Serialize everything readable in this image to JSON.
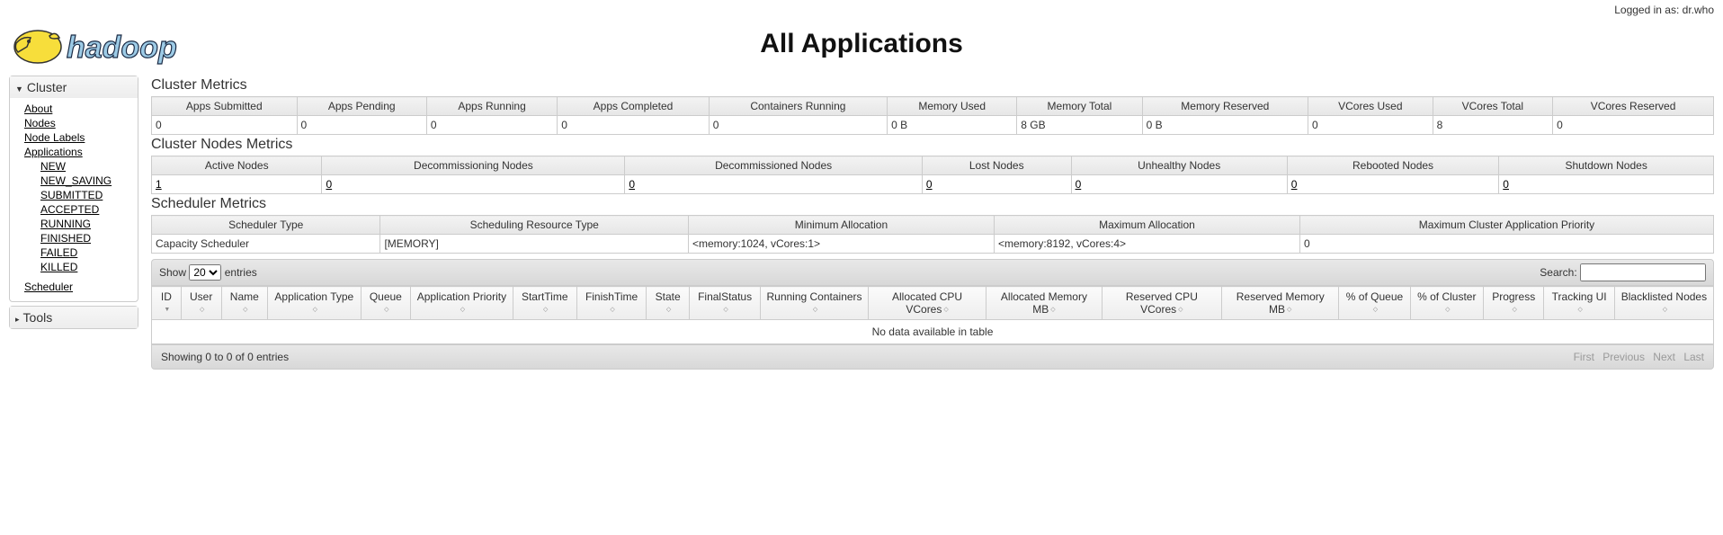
{
  "login": {
    "prefix": "Logged in as: ",
    "user": "dr.who"
  },
  "page_title": "All Applications",
  "sidebar": {
    "cluster": {
      "label": "Cluster",
      "links": {
        "about": "About",
        "nodes": "Nodes",
        "node_labels": "Node Labels",
        "applications": "Applications",
        "scheduler": "Scheduler"
      },
      "app_states": {
        "NEW": "NEW",
        "NEW_SAVING": "NEW_SAVING",
        "SUBMITTED": "SUBMITTED",
        "ACCEPTED": "ACCEPTED",
        "RUNNING": "RUNNING",
        "FINISHED": "FINISHED",
        "FAILED": "FAILED",
        "KILLED": "KILLED"
      }
    },
    "tools": {
      "label": "Tools"
    }
  },
  "sections": {
    "cluster_metrics": "Cluster Metrics",
    "cluster_nodes_metrics": "Cluster Nodes Metrics",
    "scheduler_metrics": "Scheduler Metrics"
  },
  "cluster_metrics": {
    "headers": {
      "apps_submitted": "Apps Submitted",
      "apps_pending": "Apps Pending",
      "apps_running": "Apps Running",
      "apps_completed": "Apps Completed",
      "containers_running": "Containers Running",
      "memory_used": "Memory Used",
      "memory_total": "Memory Total",
      "memory_reserved": "Memory Reserved",
      "vcores_used": "VCores Used",
      "vcores_total": "VCores Total",
      "vcores_reserved": "VCores Reserved"
    },
    "values": {
      "apps_submitted": "0",
      "apps_pending": "0",
      "apps_running": "0",
      "apps_completed": "0",
      "containers_running": "0",
      "memory_used": "0 B",
      "memory_total": "8 GB",
      "memory_reserved": "0 B",
      "vcores_used": "0",
      "vcores_total": "8",
      "vcores_reserved": "0"
    }
  },
  "nodes_metrics": {
    "headers": {
      "active": "Active Nodes",
      "decommissioning": "Decommissioning Nodes",
      "decommissioned": "Decommissioned Nodes",
      "lost": "Lost Nodes",
      "unhealthy": "Unhealthy Nodes",
      "rebooted": "Rebooted Nodes",
      "shutdown": "Shutdown Nodes"
    },
    "values": {
      "active": "1",
      "decommissioning": "0",
      "decommissioned": "0",
      "lost": "0",
      "unhealthy": "0",
      "rebooted": "0",
      "shutdown": "0"
    }
  },
  "scheduler_metrics": {
    "headers": {
      "type": "Scheduler Type",
      "resource_type": "Scheduling Resource Type",
      "min_alloc": "Minimum Allocation",
      "max_alloc": "Maximum Allocation",
      "max_priority": "Maximum Cluster Application Priority"
    },
    "values": {
      "type": "Capacity Scheduler",
      "resource_type": "[MEMORY]",
      "min_alloc": "<memory:1024, vCores:1>",
      "max_alloc": "<memory:8192, vCores:4>",
      "max_priority": "0"
    }
  },
  "datatable": {
    "show_label_pre": "Show",
    "show_label_post": "entries",
    "show_value": "20",
    "search_label": "Search:",
    "headers": {
      "id": "ID",
      "user": "User",
      "name": "Name",
      "apptype": "Application Type",
      "queue": "Queue",
      "priority": "Application Priority",
      "start": "StartTime",
      "finish": "FinishTime",
      "state": "State",
      "finalstatus": "FinalStatus",
      "running_containers": "Running Containers",
      "alloc_cpu": "Allocated CPU VCores",
      "alloc_mem": "Allocated Memory MB",
      "res_cpu": "Reserved CPU VCores",
      "res_mem": "Reserved Memory MB",
      "pct_queue": "% of Queue",
      "pct_cluster": "% of Cluster",
      "progress": "Progress",
      "tracking": "Tracking UI",
      "blacklisted": "Blacklisted Nodes"
    },
    "empty": "No data available in table",
    "info": "Showing 0 to 0 of 0 entries",
    "pager": {
      "first": "First",
      "prev": "Previous",
      "next": "Next",
      "last": "Last"
    }
  }
}
